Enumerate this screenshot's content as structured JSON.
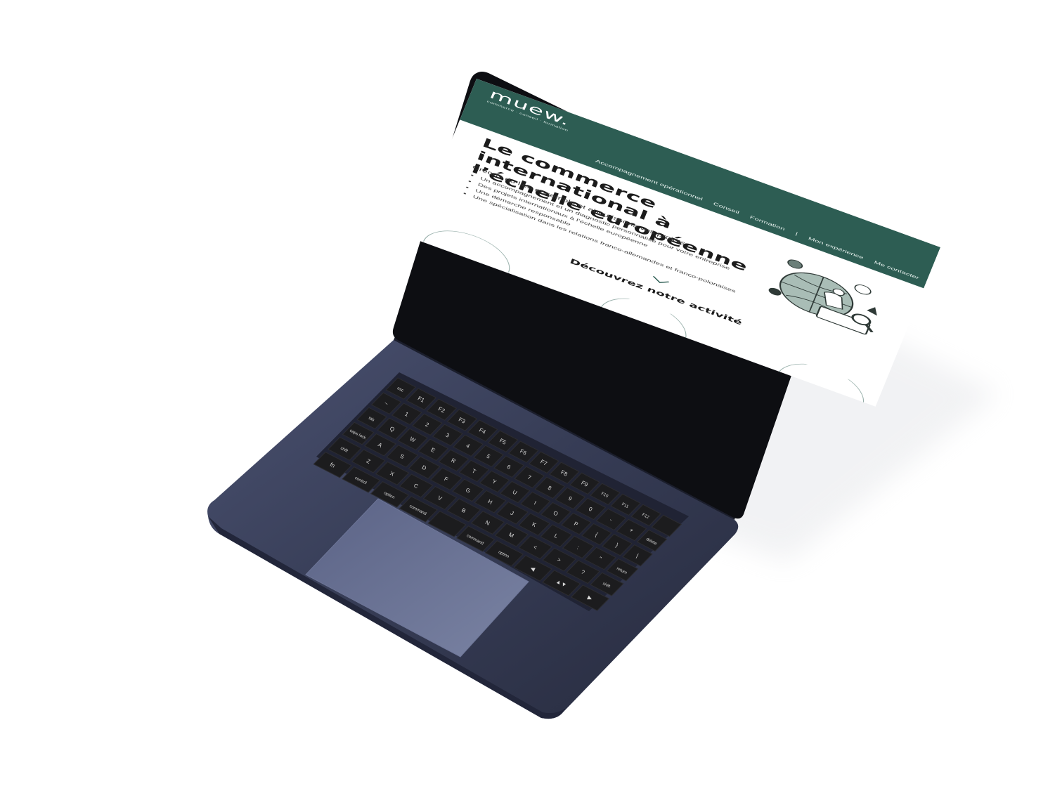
{
  "site": {
    "logo": "muew.",
    "tagline": "commerce · conseil · formation",
    "nav": [
      {
        "label": "Accompagnement opérationnel"
      },
      {
        "label": "Conseil"
      },
      {
        "label": "Formation"
      },
      {
        "label": "Mon expérience"
      },
      {
        "label": "Me contacter"
      }
    ],
    "nav_separator": "|"
  },
  "hero": {
    "title": "Le commerce international à l’échelle européenne",
    "subtitle": "Créons du lien ensemble et aboutissons vos projets",
    "bullets": [
      "Un accompagnement et un diagnostic personnalisé pour votre entreprise",
      "Des projets internationaux à l’échelle européenne",
      "Une démarche responsable",
      "Une spécialisation dans les relations franco-allemandes et franco-polonaises"
    ]
  },
  "cta": {
    "discover": "Découvrez notre activité"
  },
  "colors": {
    "brand": "#2d5d53",
    "laptop_body": "#353b52",
    "keyboard": "#1c1c1e",
    "illustration_globe": "#a9bdb6"
  },
  "keyboard": {
    "fn_row": [
      "esc",
      "F1",
      "F2",
      "F3",
      "F4",
      "F5",
      "F6",
      "F7",
      "F8",
      "F9",
      "F10",
      "F11",
      "F12",
      ""
    ],
    "num_row": [
      "~",
      "1",
      "2",
      "3",
      "4",
      "5",
      "6",
      "7",
      "8",
      "9",
      "0",
      "-",
      "+",
      "delete"
    ],
    "q_row": [
      "tab",
      "Q",
      "W",
      "E",
      "R",
      "T",
      "Y",
      "U",
      "I",
      "O",
      "P",
      "{",
      "}",
      "|"
    ],
    "a_row": [
      "caps lock",
      "A",
      "S",
      "D",
      "F",
      "G",
      "H",
      "J",
      "K",
      "L",
      ":",
      "\"",
      "return"
    ],
    "z_row": [
      "shift",
      "Z",
      "X",
      "C",
      "V",
      "B",
      "N",
      "M",
      "<",
      ">",
      "?",
      "shift"
    ],
    "bottom_row": [
      "fn",
      "control",
      "option",
      "command",
      "",
      "command",
      "option",
      "◀",
      "▲▼",
      "▶"
    ]
  }
}
